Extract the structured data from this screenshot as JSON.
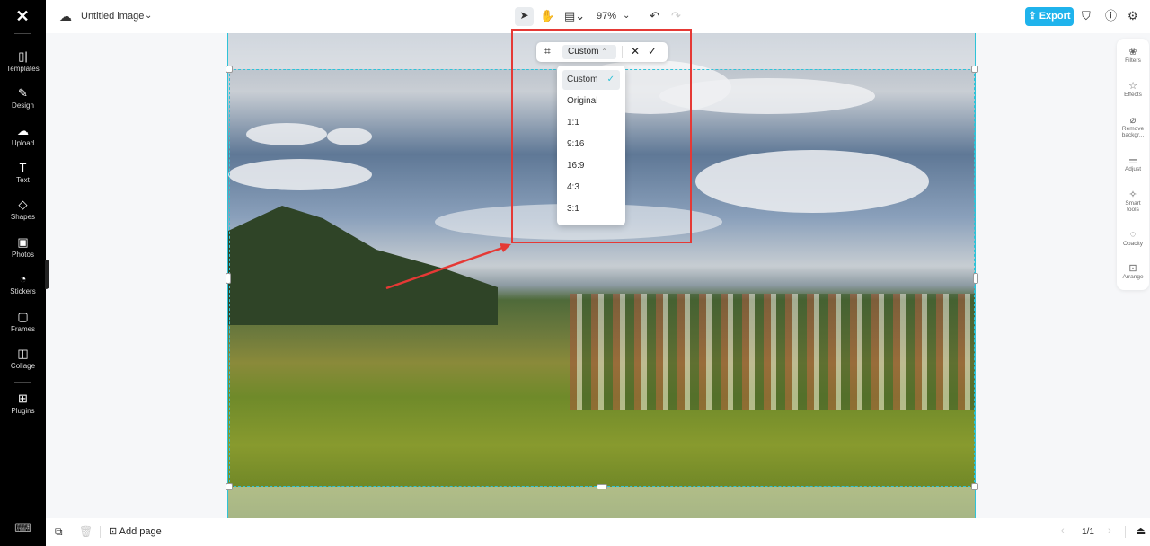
{
  "app": {
    "logo": "CapCut"
  },
  "sidebar": {
    "items": [
      {
        "label": "Templates",
        "icon": "▯|"
      },
      {
        "label": "Design",
        "icon": "✎"
      },
      {
        "label": "Upload",
        "icon": "☁"
      },
      {
        "label": "Text",
        "icon": "T"
      },
      {
        "label": "Shapes",
        "icon": "◇"
      },
      {
        "label": "Photos",
        "icon": "▣"
      },
      {
        "label": "Stickers",
        "icon": "◔"
      },
      {
        "label": "Frames",
        "icon": "▢"
      },
      {
        "label": "Collage",
        "icon": "◫"
      },
      {
        "label": "Plugins",
        "icon": "⊞"
      }
    ],
    "keyboard_icon": "⌨"
  },
  "topbar": {
    "title": "Untitled image",
    "zoom": "97%",
    "export": "Export"
  },
  "crop": {
    "ratio": "Custom",
    "options": [
      "Custom",
      "Original",
      "1:1",
      "9:16",
      "16:9",
      "4:3",
      "3:1"
    ],
    "selected": "Custom"
  },
  "rightpanel": {
    "items": [
      {
        "label": "Filters",
        "icon": "❀"
      },
      {
        "label": "Effects",
        "icon": "☆"
      },
      {
        "label": "Remove backgr...",
        "icon": "⌀"
      },
      {
        "label": "Adjust",
        "icon": "⚌"
      },
      {
        "label": "Smart tools",
        "icon": "✧"
      },
      {
        "label": "Opacity",
        "icon": "◌"
      },
      {
        "label": "Arrange",
        "icon": "⊡"
      }
    ]
  },
  "bottombar": {
    "add_page": "Add page",
    "page": "1/1"
  },
  "colors": {
    "accent": "#1fb3ec",
    "selection": "#2fc3d8",
    "annotation": "#e53935"
  }
}
